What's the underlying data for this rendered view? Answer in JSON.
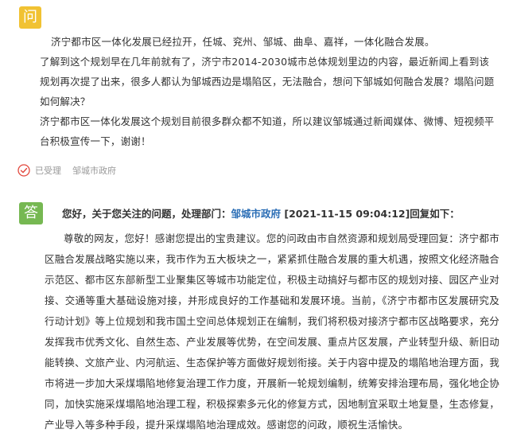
{
  "question": {
    "badge": "问",
    "para1": "济宁都市区一体化发展已经拉开，任城、兖州、邹城、曲阜、嘉祥，一体化融合发展。",
    "para2": "了解到这个规划早在几年前就有了，济宁市2014-2030城市总体规划里边的内容，最近新闻上看到该规划再次提了出来，很多人都认为邹城西边是塌陷区，无法融合，想问下邹城如何融合发展？塌陷问题如何解决？",
    "para3": "济宁都市区一体化发展这个规划目前很多群众都不知道，所以建议邹城通过新闻媒体、微博、短视频平台积极宣传一下，谢谢！"
  },
  "status": {
    "label": "已受理",
    "office": "邹城市政府",
    "icon": "check-circle-icon",
    "icon_color": "#e2483d"
  },
  "answer": {
    "badge": "答",
    "header_prefix": "您好，关于您关注的问题，处理部门：",
    "department": "邹城市政府",
    "header_suffix": " [2021-11-15 09:04:12]回复如下：",
    "body": "尊敬的网友，您好！感谢您提出的宝贵建议。您的问政由市自然资源和规划局受理回复：济宁都市区融合发展战略实施以来，我市作为五大板块之一，紧紧抓住融合发展的重大机遇，按照文化经济融合示范区、都市区东部新型工业聚集区等城市功能定位，积极主动搞好与都市区的规划对接、园区产业对接、交通等重大基础设施对接，并形成良好的工作基础和发展环境。当前，《济宁市都市区发展研究及行动计划》等上位规划和我市国土空间总体规划正在编制，我们将积极对接济宁都市区战略要求，充分发挥我市优秀文化、自然生态、产业发展等优势，在空间发展、重点片区发展，产业转型升级、新旧动能转换、文旅产业、内河航运、生态保护等方面做好规划衔接。关于内容中提及的塌陷地治理方面，我市将进一步加大采煤塌陷地修复治理工作力度，开展新一轮规划编制，统筹安排治理布局，强化地企协同，加快实施采煤塌陷地治理工程，积极探索多元化的修复方式，因地制宜采取土地复垦，生态修复，产业导入等多种手段，提升采煤塌陷地治理成效。感谢您的问政，顺祝生活愉快。"
  },
  "colors": {
    "question_badge": "#f1c232",
    "answer_badge": "#76b852",
    "department_link": "#2a6db5"
  }
}
